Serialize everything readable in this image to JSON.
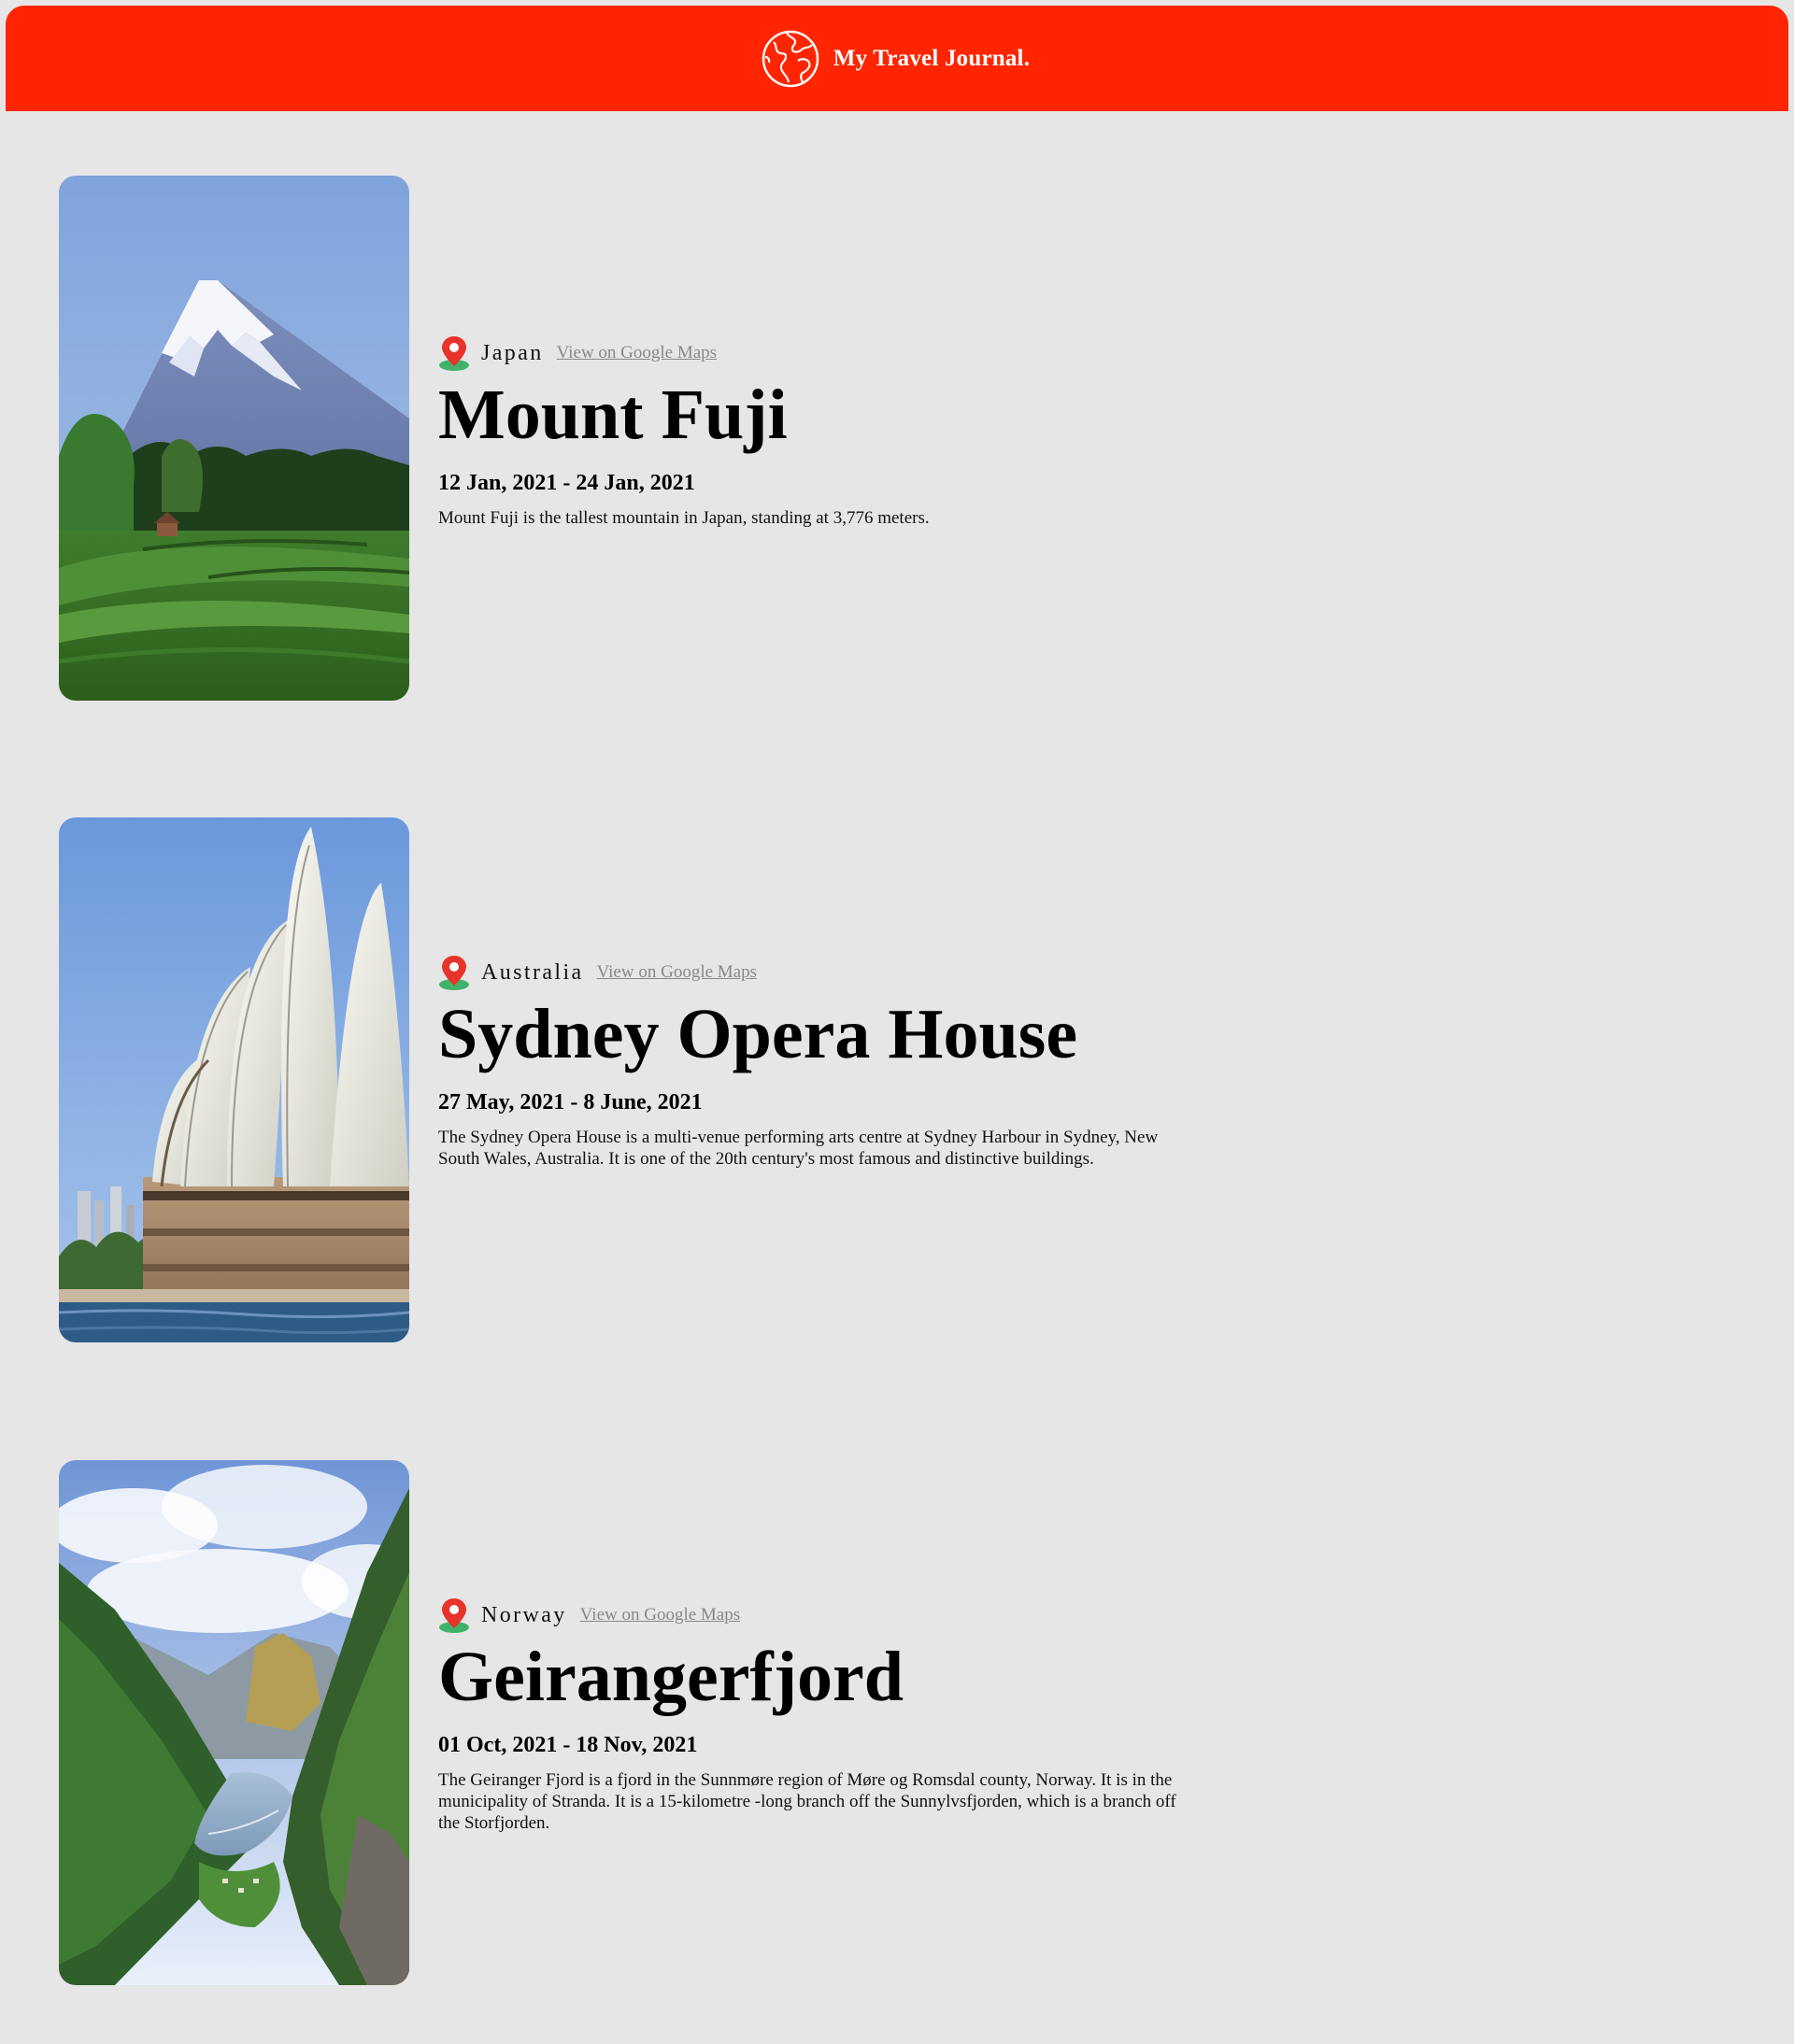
{
  "header": {
    "title": "My Travel Journal.",
    "icon": "globe-icon",
    "background": "#ff2500"
  },
  "entries": [
    {
      "country": "Japan",
      "map_link": "View on Google Maps",
      "title": "Mount Fuji",
      "dates": "12 Jan, 2021 - 24 Jan, 2021",
      "description": "Mount Fuji is the tallest mountain in Japan, standing at 3,776 meters.",
      "photo": "mount-fuji-photo"
    },
    {
      "country": "Australia",
      "map_link": "View on Google Maps",
      "title": "Sydney Opera House",
      "dates": "27 May, 2021 - 8 June, 2021",
      "description": "The Sydney Opera House is a multi-venue performing arts centre at Sydney Harbour in Sydney, New South Wales, Australia. It is one of the 20th century's most famous and distinctive buildings.",
      "photo": "sydney-opera-house-photo"
    },
    {
      "country": "Norway",
      "map_link": "View on Google Maps",
      "title": "Geirangerfjord",
      "dates": "01 Oct, 2021 - 18 Nov, 2021",
      "description": "The Geiranger Fjord is a fjord in the Sunnmøre region of Møre og Romsdal county, Norway. It is in the municipality of Stranda. It is a 15-kilometre -long branch off the Sunnylvsfjorden, which is a branch off the Storfjorden.",
      "photo": "geirangerfjord-photo"
    }
  ]
}
